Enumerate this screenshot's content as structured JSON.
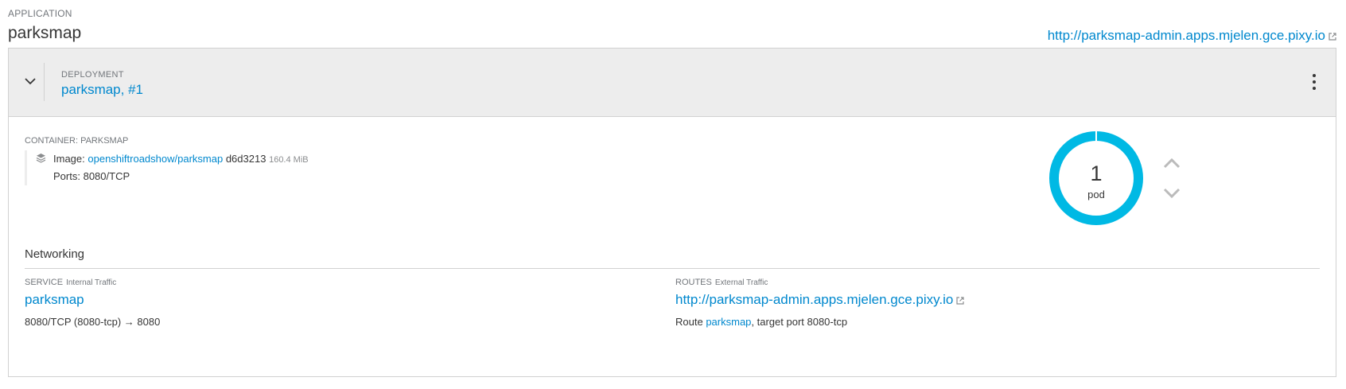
{
  "application": {
    "label": "APPLICATION",
    "name": "parksmap",
    "url": "http://parksmap-admin.apps.mjelen.gce.pixy.io"
  },
  "deployment": {
    "label": "DEPLOYMENT",
    "name": "parksmap, #1"
  },
  "container": {
    "label": "CONTAINER: PARKSMAP",
    "image_label": "Image:",
    "image_name": "openshiftroadshow/parksmap",
    "image_id": "d6d3213",
    "image_size": "160.4 MiB",
    "ports_label": "Ports:",
    "ports_value": "8080/TCP"
  },
  "pods": {
    "count": "1",
    "label": "pod",
    "ring_color": "#00b9e4"
  },
  "networking": {
    "title": "Networking",
    "service": {
      "label": "SERVICE",
      "sublabel": "Internal Traffic",
      "name": "parksmap",
      "ports": "8080/TCP (8080-tcp)",
      "arrow": "→",
      "target": "8080"
    },
    "routes": {
      "label": "ROUTES",
      "sublabel": "External Traffic",
      "url": "http://parksmap-admin.apps.mjelen.gce.pixy.io",
      "prefix": "Route",
      "route_name": "parksmap",
      "suffix": ", target port 8080-tcp"
    }
  },
  "colors": {
    "link": "#0088ce",
    "header_bg": "#ededed",
    "border": "#d1d1d1"
  }
}
